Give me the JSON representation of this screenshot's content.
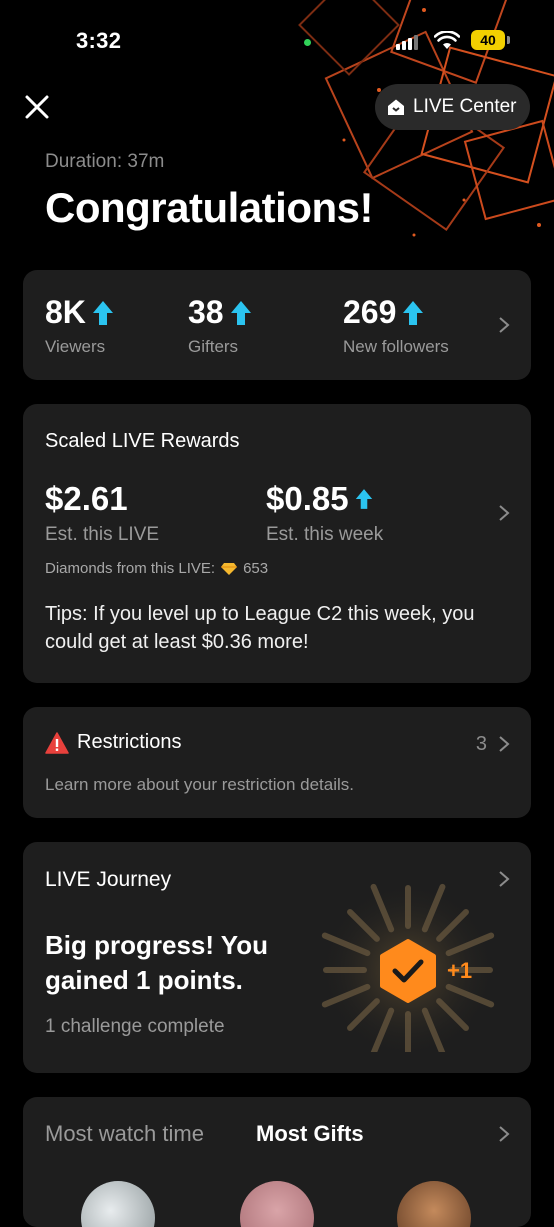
{
  "status_bar": {
    "time": "3:32",
    "battery": "40"
  },
  "header": {
    "live_center_label": "LIVE Center"
  },
  "summary": {
    "duration": "Duration: 37m",
    "title": "Congratulations!"
  },
  "stats": [
    {
      "value": "8K",
      "label": "Viewers"
    },
    {
      "value": "38",
      "label": "Gifters"
    },
    {
      "value": "269",
      "label": "New followers"
    }
  ],
  "rewards": {
    "title": "Scaled LIVE Rewards",
    "live_amount": "$2.61",
    "live_label": "Est. this LIVE",
    "week_amount": "$0.85",
    "week_label": "Est. this week",
    "diamonds_label": "Diamonds from this LIVE:",
    "diamonds_value": "653",
    "tips": "Tips: If you level up to League C2 this week, you could get at least $0.36 more!"
  },
  "restrictions": {
    "title": "Restrictions",
    "count": "3",
    "description": "Learn more about your restriction details."
  },
  "journey": {
    "title": "LIVE Journey",
    "headline": "Big progress! You gained 1 points.",
    "subtitle": "1 challenge complete",
    "points_badge": "+1"
  },
  "leaderboard": {
    "tab_watch_time": "Most watch time",
    "tab_gifts": "Most Gifts"
  },
  "colors": {
    "accent_up": "#2bc4f0",
    "warning": "#e8413c",
    "badge_orange": "#ff8a1c",
    "card_bg": "#1e1e1e"
  }
}
